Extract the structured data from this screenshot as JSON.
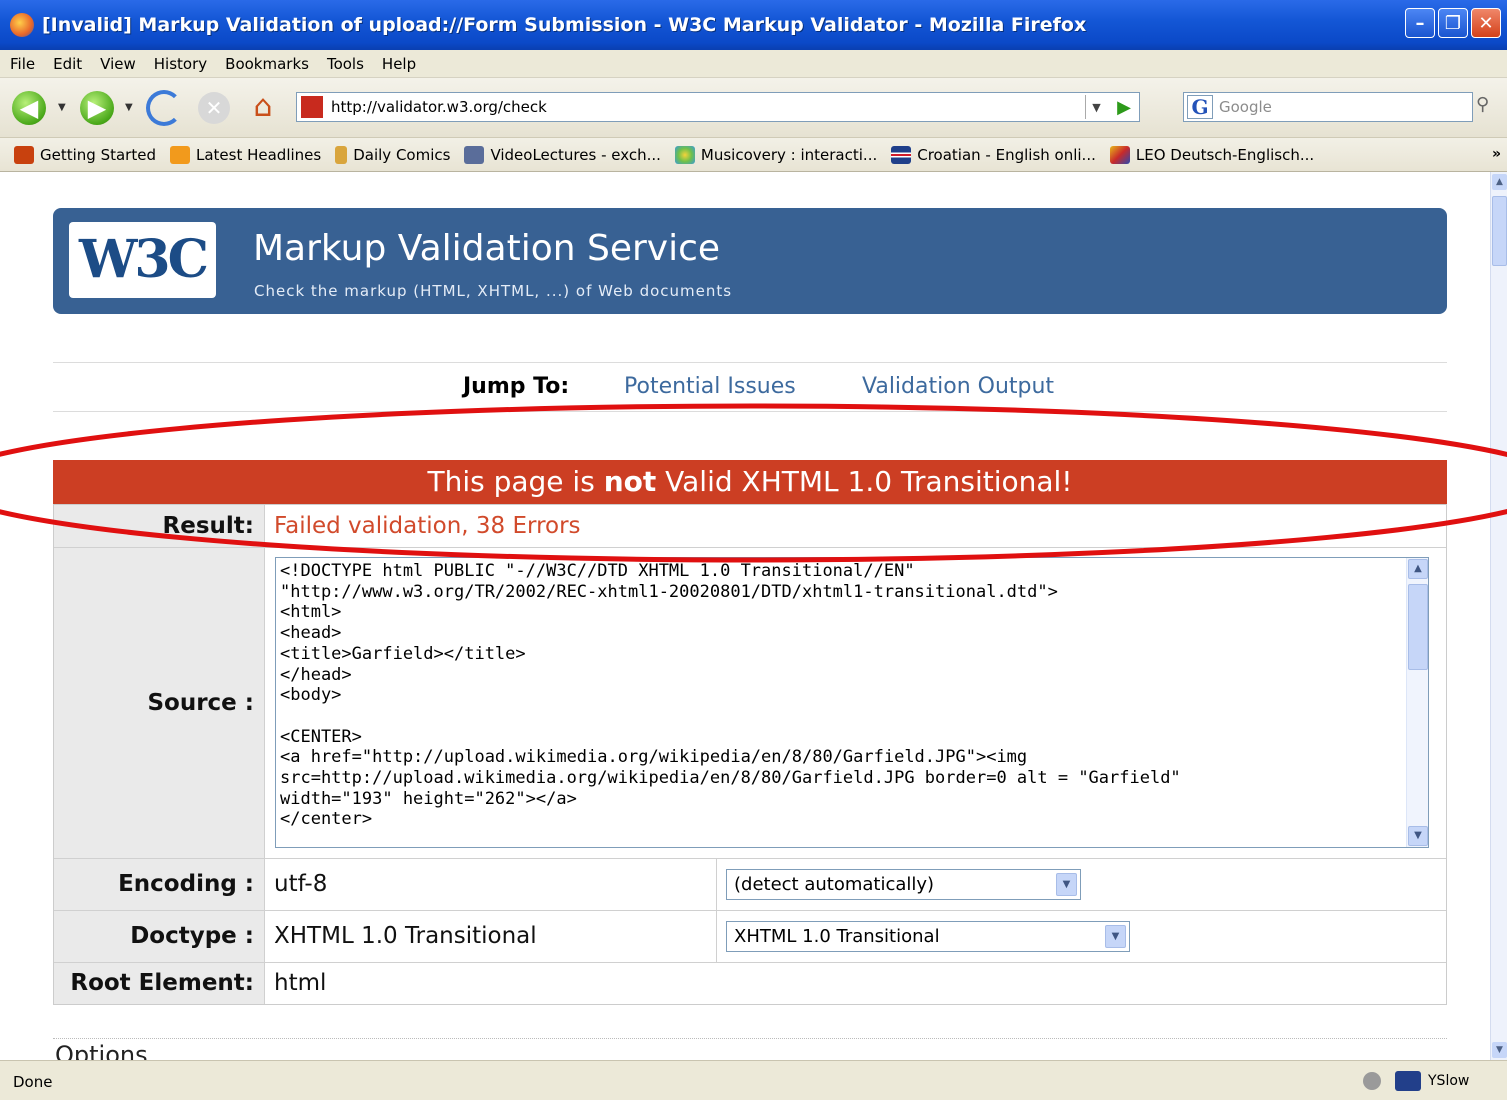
{
  "window": {
    "title": "[Invalid] Markup Validation of upload://Form Submission - W3C Markup Validator - Mozilla Firefox"
  },
  "menu": [
    "File",
    "Edit",
    "View",
    "History",
    "Bookmarks",
    "Tools",
    "Help"
  ],
  "toolbar": {
    "url": "http://validator.w3.org/check",
    "search_placeholder": "Google"
  },
  "bookmarks": [
    {
      "label": "Getting Started",
      "icon": "firefox-icon"
    },
    {
      "label": "Latest Headlines",
      "icon": "rss-icon"
    },
    {
      "label": "Daily Comics",
      "icon": "comics-icon"
    },
    {
      "label": "VideoLectures - exch...",
      "icon": "videolectures-icon"
    },
    {
      "label": "Musicovery : interacti...",
      "icon": "musicovery-icon"
    },
    {
      "label": "Croatian - English onli...",
      "icon": "uk-flag-icon"
    },
    {
      "label": "LEO Deutsch-Englisch...",
      "icon": "leo-icon"
    }
  ],
  "banner": {
    "logo": "W3C",
    "title": "Markup Validation Service",
    "subtitle": "Check the markup (HTML, XHTML, ...) of Web documents"
  },
  "jump": {
    "label": "Jump To:",
    "links": [
      "Potential Issues",
      "Validation Output"
    ]
  },
  "result": {
    "heading_pre": "This page is ",
    "heading_bold": "not",
    "heading_post": " Valid XHTML 1.0 Transitional!",
    "result_label": "Result:",
    "result_value": "Failed validation, 38 Errors",
    "source_label": "Source :",
    "source_code": "<!DOCTYPE html PUBLIC \"-//W3C//DTD XHTML 1.0 Transitional//EN\"\n\"http://www.w3.org/TR/2002/REC-xhtml1-20020801/DTD/xhtml1-transitional.dtd\">\n<html>\n<head>\n<title>Garfield></title>\n</head>\n<body>\n\n<CENTER>\n<a href=\"http://upload.wikimedia.org/wikipedia/en/8/80/Garfield.JPG\"><img\nsrc=http://upload.wikimedia.org/wikipedia/en/8/80/Garfield.JPG border=0 alt = \"Garfield\"\nwidth=\"193\" height=\"262\"></a>\n</center>",
    "encoding_label": "Encoding :",
    "encoding_value": "utf-8",
    "encoding_select": "(detect automatically)",
    "doctype_label": "Doctype :",
    "doctype_value": "XHTML 1.0 Transitional",
    "doctype_select": "XHTML 1.0 Transitional",
    "root_label": "Root Element:",
    "root_value": "html"
  },
  "options_label": "Options",
  "status": {
    "text": "Done",
    "yslow": "YSlow"
  },
  "colors": {
    "banner": "#386193",
    "error_header": "#cc3e23",
    "error_text": "#d14a2b",
    "highlight": "#e01010"
  }
}
